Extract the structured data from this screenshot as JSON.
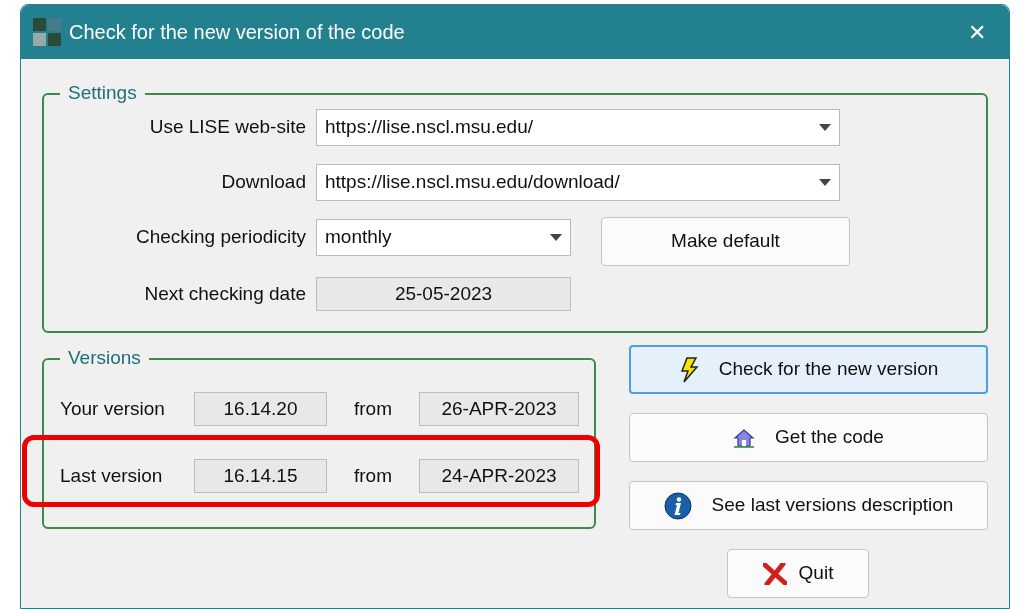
{
  "window": {
    "title": "Check for the new version of the code",
    "close": "✕"
  },
  "settings": {
    "title": "Settings",
    "fields": [
      {
        "kind": "dropdown",
        "label": "Use LISE web-site",
        "value": "https://lise.nscl.msu.edu/"
      },
      {
        "kind": "dropdown",
        "label": "Download",
        "value": "https://lise.nscl.msu.edu/download/"
      },
      {
        "kind": "dropdown-short",
        "label": "Checking periodicity",
        "value": "monthly"
      },
      {
        "kind": "readonly",
        "label": "Next checking date",
        "value": "25-05-2023"
      }
    ],
    "make_default_button": "Make default"
  },
  "versions": {
    "title": "Versions",
    "rows": [
      {
        "label": "Your version",
        "version": "16.14.20",
        "from": "from",
        "date": "26-APR-2023",
        "highlighted": false
      },
      {
        "label": "Last version",
        "version": "16.14.15",
        "from": "from",
        "date": "24-APR-2023",
        "highlighted": true
      }
    ]
  },
  "buttons": [
    {
      "kind": "check",
      "label": "Check for the new version",
      "focused": true
    },
    {
      "kind": "home",
      "label": "Get the code",
      "focused": false
    },
    {
      "kind": "info",
      "label": "See last versions description",
      "focused": false
    }
  ],
  "quit_button": {
    "label": "Quit"
  }
}
